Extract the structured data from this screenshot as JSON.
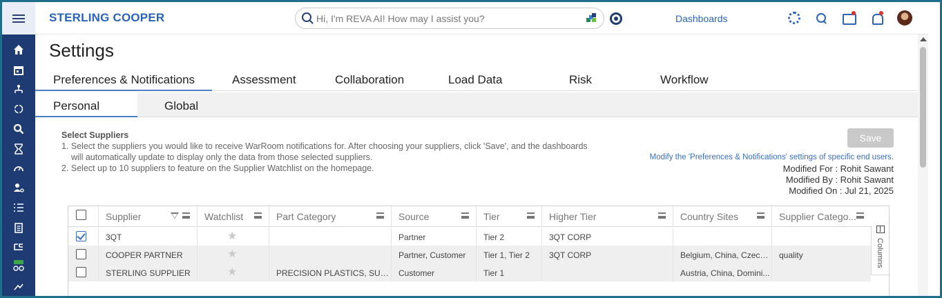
{
  "header": {
    "brand": "STERLING COOPER",
    "search_placeholder": "Hi, I'm REVA AI! How may I assist you?",
    "dashboards_link": "Dashboards"
  },
  "sidebar": {
    "items": [
      "home-icon",
      "calendar-icon",
      "hierarchy-icon",
      "refresh-icon",
      "search-person-icon",
      "hourglass-icon",
      "gauge-icon",
      "user-settings-icon",
      "list-icon",
      "clipboard-icon",
      "org-chart-icon",
      "new-network-icon",
      "handshake-icon"
    ]
  },
  "page": {
    "title": "Settings"
  },
  "tabs": {
    "primary": [
      "Preferences & Notifications",
      "Assessment",
      "Collaboration",
      "Load Data",
      "Risk",
      "Workflow"
    ],
    "secondary": [
      "Personal",
      "Global"
    ]
  },
  "instructions": {
    "heading": "Select Suppliers",
    "line1a": "1. Select the suppliers you would like to receive WarRoom notifications for. After choosing your suppliers, click 'Save', and the dashboards",
    "line1b": "will automatically update to display only the data from those selected suppliers.",
    "line2": "2. Select up to 10 suppliers to feature on the Supplier Watchlist on the homepage."
  },
  "actions": {
    "save_label": "Save",
    "modify_link": "Modify the 'Preferences & Notifications' settings of specific end users."
  },
  "meta": {
    "modified_for": "Modified For :  Rohit Sawant",
    "modified_by": "Modified By :  Rohit Sawant",
    "modified_on": "Modified On :  Jul 21, 2025"
  },
  "grid": {
    "columns": [
      "Supplier",
      "Watchlist",
      "Part Category",
      "Source",
      "Tier",
      "Higher Tier",
      "Country Sites",
      "Supplier Catego..."
    ],
    "rows": [
      {
        "checked": true,
        "supplier": "3QT",
        "part_category": "",
        "source": "Partner",
        "tier": "Tier 2",
        "higher_tier": "3QT CORP",
        "country_sites": "",
        "supplier_category": ""
      },
      {
        "checked": false,
        "supplier": "COOPER PARTNER",
        "part_category": "",
        "source": "Partner, Customer",
        "tier": "Tier 1, Tier 2",
        "higher_tier": "3QT CORP",
        "country_sites": "Belgium, China, Czechi...",
        "supplier_category": "quality"
      },
      {
        "checked": false,
        "supplier": "STERLING SUPPLIER",
        "part_category": "PRECISION PLASTICS, SUPP...",
        "source": "Customer",
        "tier": "Tier 1",
        "higher_tier": "",
        "country_sites": "Austria, China, Domini...",
        "supplier_category": ""
      }
    ],
    "columns_panel_label": "Columns"
  },
  "colors": {
    "sidebar": "#1f3b73",
    "brand": "#2a63b8",
    "accent": "#4a7fc6",
    "frame": "#1e6d8a"
  }
}
